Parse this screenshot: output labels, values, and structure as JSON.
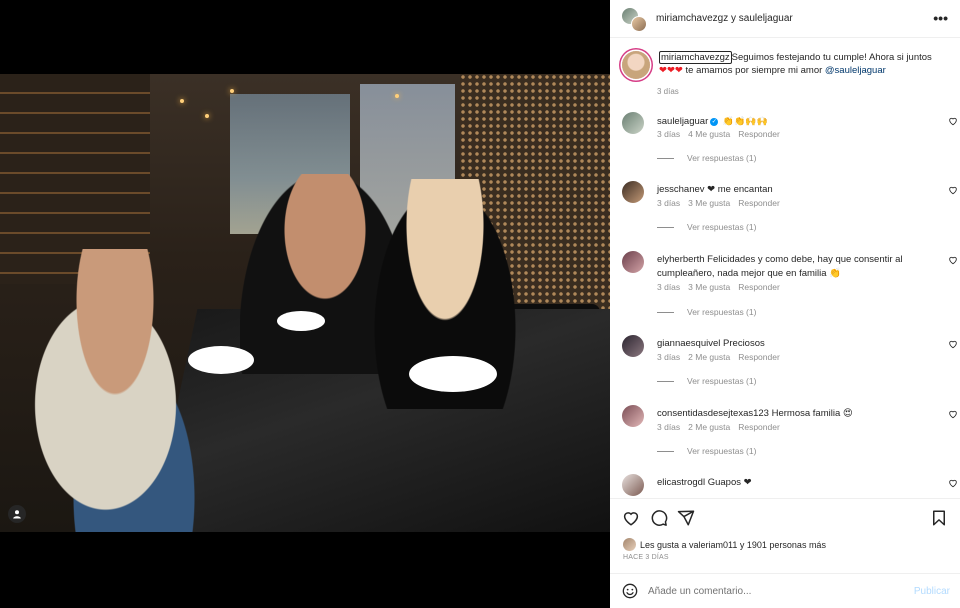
{
  "header": {
    "names": "miriamchavezgz y sauleljaguar"
  },
  "caption": {
    "user": "miriamchavezgz",
    "text_1": "Seguimos festejando tu cumple! Ahora si juntos",
    "hearts": "❤❤❤",
    "text_2": " te amamos por siempre mi amor ",
    "mention": "@sauleljaguar",
    "time": "3 días"
  },
  "comments": [
    {
      "user": "sauleljaguar",
      "verified": true,
      "text": "👏👏🙌🙌",
      "time": "3 días",
      "likes": "4 Me gusta",
      "reply": "Responder",
      "replies": "Ver respuestas (1)"
    },
    {
      "user": "jesschanev",
      "text": "❤ me encantan",
      "time": "3 días",
      "likes": "3 Me gusta",
      "reply": "Responder",
      "replies": "Ver respuestas (1)"
    },
    {
      "user": "elyherberth",
      "text": "Felicidades y como debe, hay que consentir al cumpleañero, nada mejor que en familia 👏",
      "time": "3 días",
      "likes": "3 Me gusta",
      "reply": "Responder",
      "replies": "Ver respuestas (1)"
    },
    {
      "user": "giannaesquivel",
      "text": "Preciosos",
      "time": "3 días",
      "likes": "2 Me gusta",
      "reply": "Responder",
      "replies": "Ver respuestas (1)"
    },
    {
      "user": "consentidasdesejtexas123",
      "text": "Hermosa familia 😍",
      "time": "3 días",
      "likes": "2 Me gusta",
      "reply": "Responder",
      "replies": "Ver respuestas (1)"
    },
    {
      "user": "elicastrogdl",
      "text": "Guapos ❤"
    }
  ],
  "actions": {
    "likes_text": "Les gusta a valeriam011 y 1901 personas más",
    "ago": "HACE 3 DÍAS"
  },
  "composer": {
    "placeholder": "Añade un comentario...",
    "post": "Publicar"
  },
  "colors": {
    "link": "#00376b",
    "verified": "#0095f6",
    "story_ring": "#d63d86",
    "publish_disabled": "#b3dbff",
    "secondary_text": "#8e8e8e"
  }
}
